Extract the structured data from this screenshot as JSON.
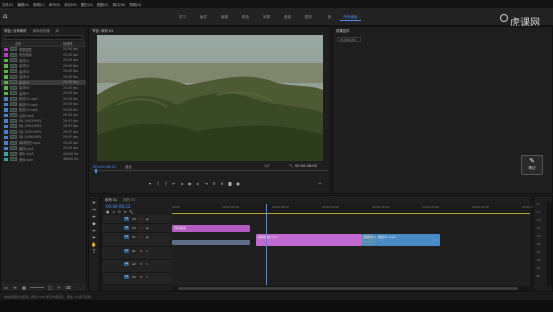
{
  "menu": [
    "文件(F)",
    "编辑(E)",
    "剪辑(C)",
    "序列(S)",
    "标记(M)",
    "图形(G)",
    "视图(V)",
    "窗口(W)",
    "帮助(H)"
  ],
  "workspace_tabs": [
    "学习",
    "组件",
    "编辑",
    "颜色",
    "效果",
    "音频",
    "图形",
    "库",
    "所有面板"
  ],
  "workspace_active_index": 8,
  "watermark": "虎课网",
  "project_panel": {
    "tabs": [
      "项目: 分享素材",
      "媒体浏览器",
      "库"
    ],
    "search_placeholder": "",
    "name_header": "名称",
    "fps_header": "帧速率",
    "items": [
      {
        "name": "调整图层",
        "fps": "25.00 fps",
        "color": "#b040c0"
      },
      {
        "name": "彩色蒙版",
        "fps": "25.00 fps",
        "color": "#b040c0"
      },
      {
        "name": "素材01",
        "fps": "25.00 fps",
        "color": "#5bb04a"
      },
      {
        "name": "素材02",
        "fps": "25.00 fps",
        "color": "#5bb04a"
      },
      {
        "name": "素材03",
        "fps": "25.00 fps",
        "color": "#5bb04a"
      },
      {
        "name": "素材04",
        "fps": "25.00 fps",
        "color": "#5bb04a"
      },
      {
        "name": "素材05",
        "fps": "25.00 fps",
        "color": "#5bb04a"
      },
      {
        "name": "素材06",
        "fps": "25.00 fps",
        "color": "#5bb04a"
      },
      {
        "name": "素材07",
        "fps": "25.00 fps",
        "color": "#5bb04a"
      },
      {
        "name": "航拍01.mp4",
        "fps": "25.00 fps",
        "color": "#4a7fc8"
      },
      {
        "name": "航拍02.mp4",
        "fps": "25.00 fps",
        "color": "#4a7fc8"
      },
      {
        "name": "航拍03.mp4",
        "fps": "25.00 fps",
        "color": "#4a7fc8"
      },
      {
        "name": "山景.mp4",
        "fps": "25.00 fps",
        "color": "#4a7fc8"
      },
      {
        "name": "DJI_0003.MOV",
        "fps": "29.97 fps",
        "color": "#4a7fc8"
      },
      {
        "name": "DJI_0004.MOV",
        "fps": "29.97 fps",
        "color": "#4a7fc8"
      },
      {
        "name": "DJI_0005.MOV",
        "fps": "29.97 fps",
        "color": "#4a7fc8"
      },
      {
        "name": "DJI_0006.MOV",
        "fps": "29.97 fps",
        "color": "#4a7fc8"
      },
      {
        "name": "森林航拍.mp4",
        "fps": "25.00 fps",
        "color": "#4a7fc8"
      },
      {
        "name": "森林.mp4",
        "fps": "25.00 fps",
        "color": "#4a7fc8"
      },
      {
        "name": "音乐.mp3",
        "fps": "44100 Hz",
        "color": "#3fa0a0"
      },
      {
        "name": "音效.wav",
        "fps": "48000 Hz",
        "color": "#3fa0a0"
      }
    ],
    "selected_index": 6
  },
  "program_monitor": {
    "tab": "节目: 序列 01",
    "timecode_left": "00:00:08:22",
    "fit": "适合",
    "fraction": "1/2",
    "timecode_right": "00:00:28:00"
  },
  "effect_controls": {
    "tab": "效果控件",
    "no_clip": "(未选择剪辑)"
  },
  "note_button": "笔记",
  "timeline": {
    "tabs": [
      "序列 01",
      "序列 02"
    ],
    "timecode": "00:00:08:22",
    "ruler_labels": [
      "00:00",
      "00:00:04:00",
      "00:00:08:00",
      "00:00:12:00",
      "00:00:16:00",
      "00:00:20:00",
      "00:00:24:00",
      "00:00:28:00"
    ],
    "video_tracks": [
      "V3",
      "V2",
      "V1"
    ],
    "audio_tracks": [
      "A1",
      "A2",
      "A3"
    ],
    "clips": [
      {
        "label": "调整图层",
        "track": "V2",
        "color": "#b65bc4"
      },
      {
        "label": "森林航拍.mp4",
        "track": "V1",
        "color": "#c06ad0"
      },
      {
        "label": "航拍02.mp4",
        "track": "V1",
        "color": "#5a8fb8"
      },
      {
        "label": "航拍01.mp4",
        "track": "V1",
        "color": "#4a8bc8"
      }
    ]
  },
  "status_bar": "单击并拖动以框选。按住 Shift 键可扩展选区，按住 Alt 键可选择...",
  "ruler_tags": [
    "-6",
    "-12",
    "-18",
    "-24",
    "-30",
    "-36",
    "-42",
    "-48",
    "-54",
    "dB"
  ]
}
